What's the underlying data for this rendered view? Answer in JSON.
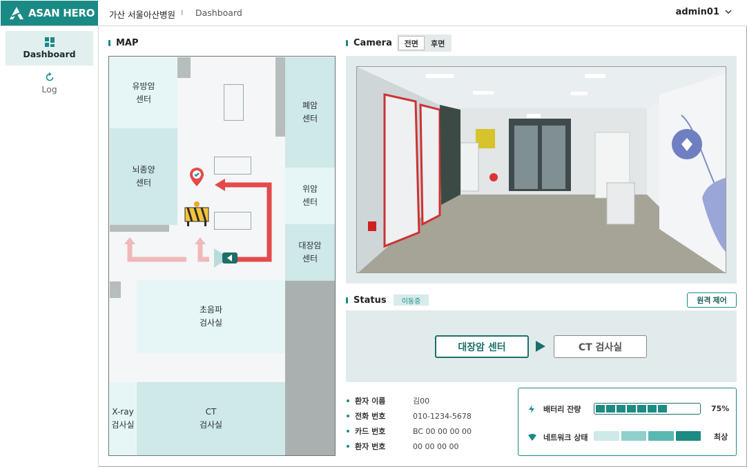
{
  "app": {
    "brand": "ASAN HERO",
    "hospital": "가산 서울아산병원",
    "separator": "I",
    "breadcrumb": "Dashboard",
    "user": "admin01",
    "accent": "#1a8a85"
  },
  "sidebar": {
    "items": [
      {
        "label": "Dashboard",
        "icon": "dashboard-grid-icon",
        "active": true
      },
      {
        "label": "Log",
        "icon": "refresh-icon",
        "active": false
      }
    ]
  },
  "map": {
    "title": "MAP",
    "rooms": [
      {
        "name": "유방암\n센터"
      },
      {
        "name": "뇌종양\n센터"
      },
      {
        "name": "폐암\n센터"
      },
      {
        "name": "위암\n센터"
      },
      {
        "name": "대장암\n센터"
      },
      {
        "name": "초음파\n검사실"
      },
      {
        "name": "X-ray\n검사실"
      },
      {
        "name": "CT\n검사실"
      }
    ],
    "icons": [
      "location-check-icon",
      "barricade-icon",
      "robot-marker-icon",
      "route-arrow-icon"
    ]
  },
  "camera": {
    "title": "Camera",
    "tabs": [
      {
        "label": "전면",
        "active": true
      },
      {
        "label": "후면",
        "active": false
      }
    ]
  },
  "status": {
    "title": "Status",
    "badge": "이동중",
    "remote_button": "원격 제어",
    "route_from": "대장암 센터",
    "route_to": "CT 검사실",
    "patient": [
      {
        "key": "환자 이름",
        "value": "김00"
      },
      {
        "key": "전화 번호",
        "value": "010-1234-5678"
      },
      {
        "key": "카드 번호",
        "value": "BC 00 00 00 00"
      },
      {
        "key": "환자 번호",
        "value": "00 00 00 00"
      }
    ],
    "device": {
      "battery_label": "배터리 잔량",
      "battery_percent": "75%",
      "battery_fraction": 0.75,
      "battery_segments_filled": 7,
      "network_label": "네트워크 상태",
      "network_level": "최상",
      "network_bars": 4,
      "network_colors": [
        "#cfe8e8",
        "#8fcfcc",
        "#5ab8b3",
        "#1d8a84"
      ]
    }
  }
}
